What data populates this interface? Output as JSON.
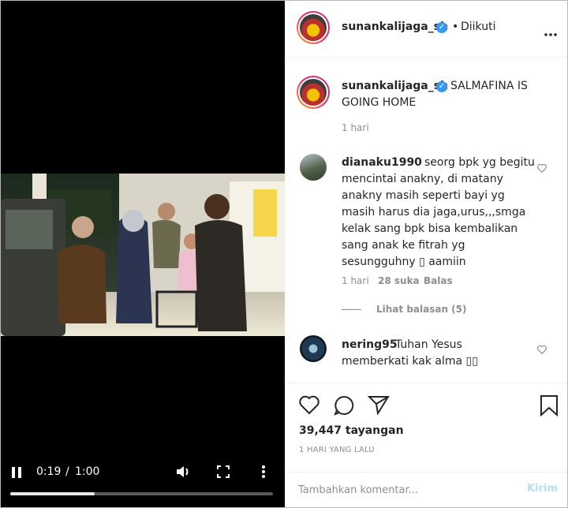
{
  "video": {
    "time_current": "0:19",
    "time_separator": "/",
    "time_total": "1:00",
    "progress": 0.32
  },
  "post_header": {
    "username": "sunankalijaga_sh",
    "separator": "•",
    "follow_status": "Diikuti"
  },
  "caption": {
    "username": "sunankalijaga_sh",
    "text_line1": "SALMAFINA IS",
    "text_line2": "GOING HOME",
    "time": "1 hari"
  },
  "comments": [
    {
      "username": "dianaku1990",
      "lines": [
        "seorg bpk yg begitu",
        "mencintai anakny, di matany",
        "anakny masih seperti bayi yg",
        "masih harus dia jaga,urus,,,smga",
        "kelak sang bpk bisa kembalikan",
        "sang anak ke fitrah yg",
        "sesungguhny ▯ aamiin"
      ],
      "time": "1 hari",
      "likes": "28 suka",
      "reply": "Balas",
      "view_replies": "Lihat balasan (5)"
    },
    {
      "username": "nering95",
      "lines": [
        "Tuhan Yesus",
        "memberkati kak alma ▯▯"
      ]
    }
  ],
  "stats": {
    "views": "39,447 tayangan",
    "date": "1 HARI YANG LALU"
  },
  "add_comment": {
    "placeholder": "Tambahkan komentar...",
    "send_label": "Kirim"
  },
  "colors": {
    "verified": "#3897f0",
    "send_disabled": "#b2dffc"
  }
}
